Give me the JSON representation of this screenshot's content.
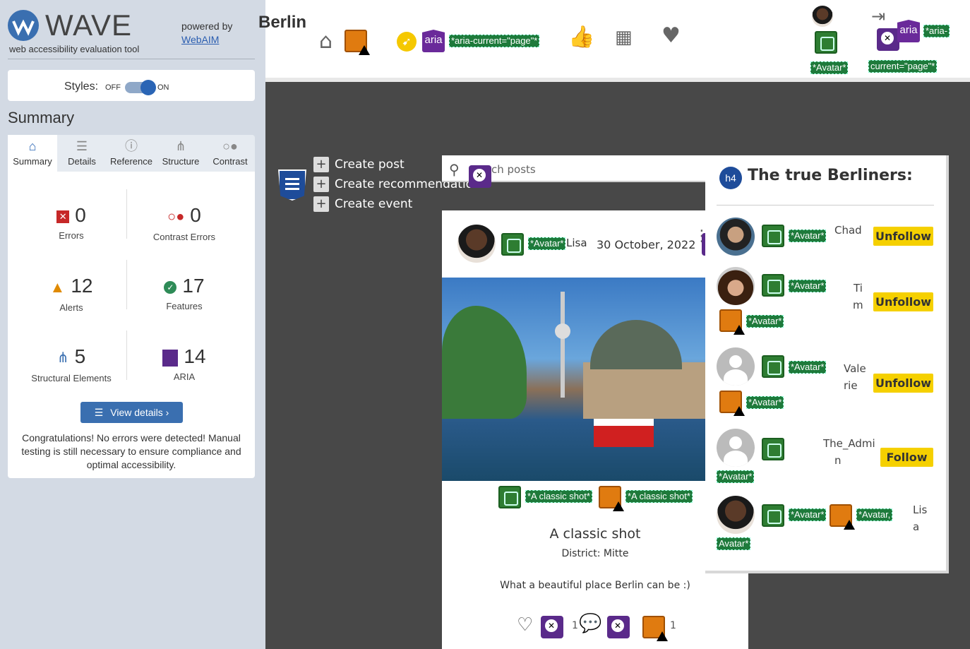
{
  "wave": {
    "logo": "WAVE",
    "subtitle": "web accessibility evaluation tool",
    "powered_by": "powered by",
    "webaim_link": "WebAIM",
    "styles_label": "Styles:",
    "styles_off": "OFF",
    "styles_on": "ON",
    "summary_heading": "Summary",
    "tabs": [
      {
        "label": "Summary",
        "icon": "home-icon"
      },
      {
        "label": "Details",
        "icon": "list-icon"
      },
      {
        "label": "Reference",
        "icon": "info-icon"
      },
      {
        "label": "Structure",
        "icon": "hierarchy-icon"
      },
      {
        "label": "Contrast",
        "icon": "contrast-icon"
      }
    ],
    "stats": {
      "errors": {
        "value": "0",
        "label": "Errors"
      },
      "contrast": {
        "value": "0",
        "label": "Contrast Errors"
      },
      "alerts": {
        "value": "12",
        "label": "Alerts"
      },
      "features": {
        "value": "17",
        "label": "Features"
      },
      "structural": {
        "value": "5",
        "label": "Structural Elements"
      },
      "aria": {
        "value": "14",
        "label": "ARIA"
      }
    },
    "view_details": "View details ›",
    "congrats": "Congratulations! No errors were detected! Manual testing is still necessary to ensure compliance and optimal accessibility."
  },
  "site": {
    "brand": "Berlin",
    "tags": {
      "aria_current": "*aria-current=\"page\"*",
      "avatar": "*Avatar*",
      "aria_current_a": "*aria-",
      "aria_current_b": "current=\"page\"*",
      "aria": "aria"
    },
    "menu": [
      "Create post",
      "Create recommendation",
      "Create event"
    ],
    "search_placeholder": "ch posts",
    "post": {
      "author": "Lisa",
      "avatar_tag": "*Avatar*",
      "date": "30 October, 2022",
      "image_tag1": "*A classic shot*",
      "image_tag2": "*A classic shot*",
      "title": "A classic shot",
      "district": "District: Mitte",
      "description": "What a beautiful place Berlin can be :)",
      "likes": "1",
      "comments": "1"
    },
    "sidebar": {
      "heading_badge": "h4",
      "title": "The true Berliners:",
      "users": [
        {
          "name": "Chad",
          "button": "Unfollow"
        },
        {
          "name_a": "Ti",
          "name_b": "m",
          "button": "Unfollow"
        },
        {
          "name_a": "Vale",
          "name_b": "rie",
          "button": "Unfollow"
        },
        {
          "name_a": "The_Admi",
          "name_b": "n",
          "button": "Follow"
        },
        {
          "name_a": "Lis",
          "name_b": "a",
          "button": ""
        }
      ],
      "avatar_tag": "*Avatar*",
      "avatar_tag2": "*Avatar,",
      "avatar_tag3": "Avatar*"
    }
  },
  "colors": {
    "wave_bg": "#d3dae4",
    "accent": "#3a6fb0",
    "follow_yellow": "#f5d000",
    "tag_green": "#1e7a3b"
  }
}
